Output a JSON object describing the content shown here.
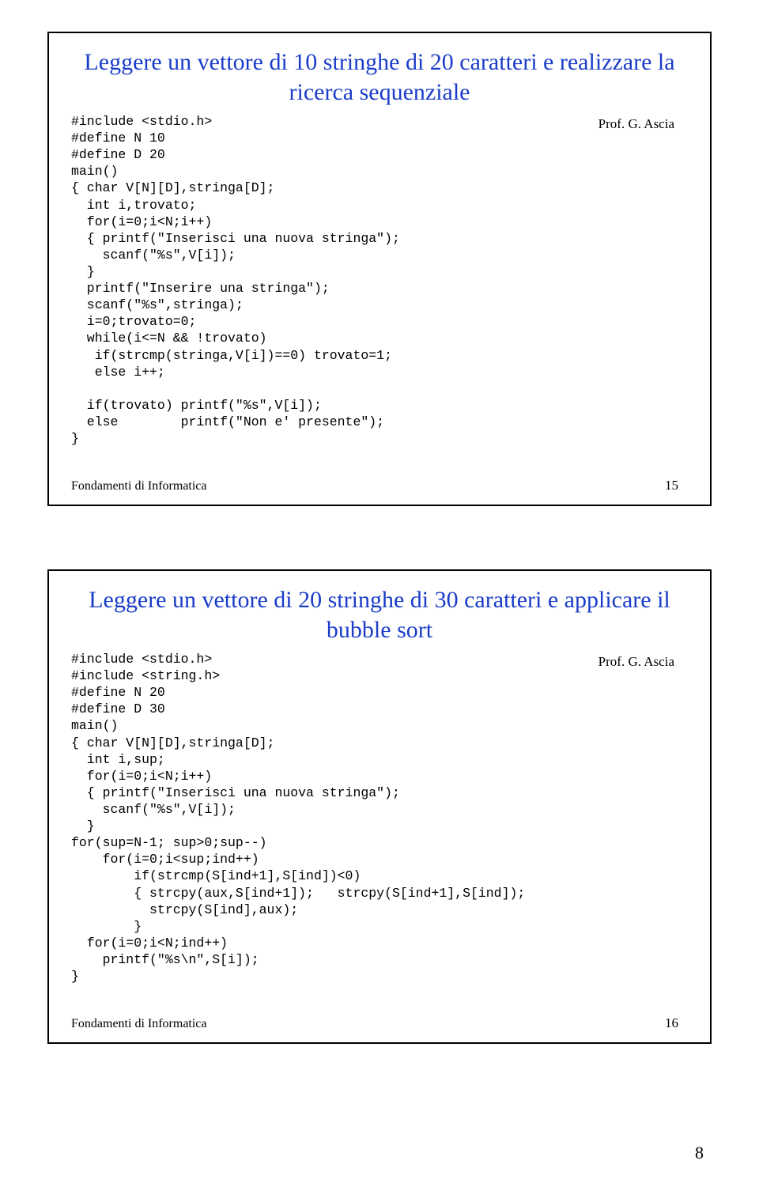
{
  "page_number": "8",
  "slide1": {
    "title": "Leggere un vettore di 10 stringhe di 20 caratteri\ne realizzare la ricerca sequenziale",
    "prof": "Prof. G. Ascia",
    "code": "#include <stdio.h>\n#define N 10\n#define D 20\nmain()\n{ char V[N][D],stringa[D];\n  int i,trovato;\n  for(i=0;i<N;i++)\n  { printf(\"Inserisci una nuova stringa\");\n    scanf(\"%s\",V[i]);\n  }\n  printf(\"Inserire una stringa\");\n  scanf(\"%s\",stringa);\n  i=0;trovato=0;\n  while(i<=N && !trovato)\n   if(strcmp(stringa,V[i])==0) trovato=1;\n   else i++;\n\n  if(trovato) printf(\"%s\",V[i]);\n  else        printf(\"Non e' presente\");\n}",
    "footer_left": "Fondamenti di Informatica",
    "footer_right": "15"
  },
  "slide2": {
    "title": "Leggere un vettore di 20 stringhe di 30 caratteri\ne applicare il bubble sort",
    "prof": "Prof. G. Ascia",
    "code": "#include <stdio.h>\n#include <string.h>\n#define N 20\n#define D 30\nmain()\n{ char V[N][D],stringa[D];\n  int i,sup;\n  for(i=0;i<N;i++)\n  { printf(\"Inserisci una nuova stringa\");\n    scanf(\"%s\",V[i]);\n  }\nfor(sup=N-1; sup>0;sup--)\n    for(i=0;i<sup;ind++)\n        if(strcmp(S[ind+1],S[ind])<0)\n        { strcpy(aux,S[ind+1]);   strcpy(S[ind+1],S[ind]);\n          strcpy(S[ind],aux);\n        }\n  for(i=0;i<N;ind++)\n    printf(\"%s\\n\",S[i]);\n}",
    "footer_left": "Fondamenti di Informatica",
    "footer_right": "16"
  }
}
